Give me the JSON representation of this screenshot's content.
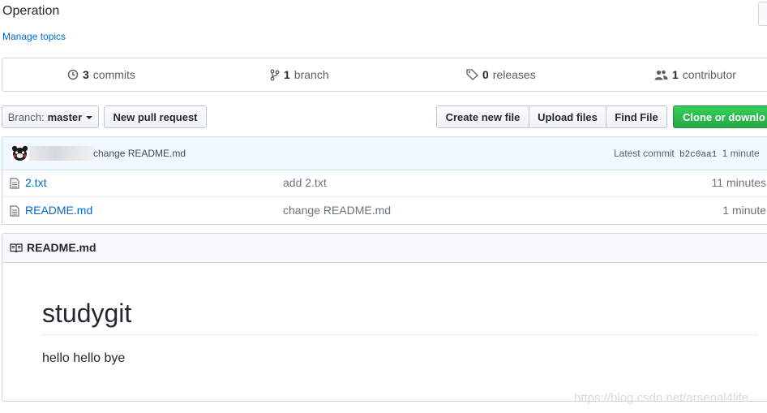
{
  "repo": {
    "description": "Operation",
    "manage_topics": "Manage topics"
  },
  "summary": {
    "commits_count": "3",
    "commits_label": "commits",
    "branch_count": "1",
    "branch_label": "branch",
    "releases_count": "0",
    "releases_label": "releases",
    "contributors_count": "1",
    "contributors_label": "contributor"
  },
  "toolbar": {
    "branch_label": "Branch:",
    "branch_value": "master",
    "new_pull_request": "New pull request",
    "create_new_file": "Create new file",
    "upload_files": "Upload files",
    "find_file": "Find File",
    "clone_or_download": "Clone or downlo"
  },
  "latest_commit": {
    "message": "change README.md",
    "prefix": "Latest commit",
    "sha": "b2c0aa1",
    "age": "1 minute"
  },
  "files": [
    {
      "name": "2.txt",
      "commit": "add 2.txt",
      "age": "11 minutes"
    },
    {
      "name": "README.md",
      "commit": "change README.md",
      "age": "1 minute"
    }
  ],
  "readme": {
    "header": "README.md",
    "heading": "studygit",
    "body": "hello hello bye"
  },
  "watermark": "https://blog.csdn.net/arsenal4life",
  "colors": {
    "link": "#0366d6",
    "clone_button": "#28a745",
    "commit_tease_bg": "#f1f8ff"
  }
}
